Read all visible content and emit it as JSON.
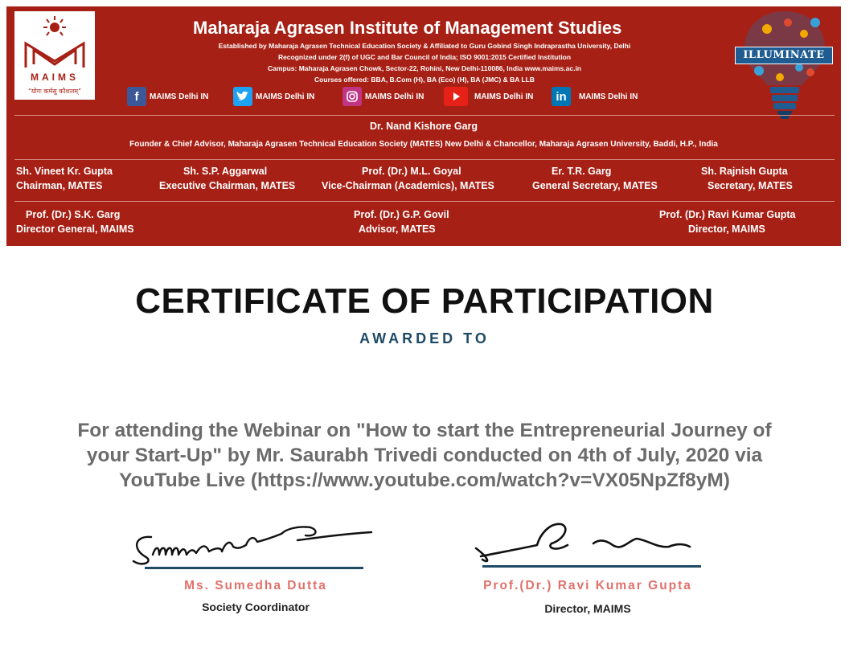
{
  "header": {
    "logo_text": "MAIMS",
    "logo_motto": "“योगः कर्मसु कौशलम्”",
    "institute_name": "Maharaja Agrasen Institute of Management Studies",
    "lines": [
      "Established by Maharaja Agrasen Technical Education Society & Affiliated to Guru Gobind Singh Indraprastha University, Delhi",
      "Recognized under 2(f) of UGC and Bar Council of India; ISO 9001:2015 Certified Institution",
      "Campus: Maharaja Agrasen Chowk, Sector-22, Rohini, New Delhi-110086, India www.maims.ac.in",
      "Courses offered: BBA, B.Com (H), BA (Eco) (H), BA (JMC) & BA LLB"
    ],
    "social": [
      {
        "icon": "facebook-icon",
        "label": "MAIMS Delhi IN",
        "color": "#3b5998"
      },
      {
        "icon": "twitter-icon",
        "label": "MAIMS Delhi IN",
        "color": "#1da1f2"
      },
      {
        "icon": "instagram-icon",
        "label": "MAIMS Delhi IN",
        "color": "#c13584"
      },
      {
        "icon": "youtube-icon",
        "label": "MAIMS Delhi IN",
        "color": "#e62117"
      },
      {
        "icon": "linkedin-icon",
        "label": "MAIMS Delhi IN",
        "color": "#0077b5"
      }
    ],
    "illuminate_label": "ILLUMINATE",
    "founder_name": "Dr. Nand Kishore Garg",
    "founder_role": "Founder & Chief Advisor, Maharaja Agrasen Technical Education Society (MATES) New Delhi & Chancellor, Maharaja Agrasen University, Baddi, H.P., India",
    "row1": [
      {
        "name": "Sh. Vineet Kr. Gupta",
        "role": "Chairman, MATES"
      },
      {
        "name": "Sh. S.P. Aggarwal",
        "role": "Executive Chairman, MATES"
      },
      {
        "name": "Prof. (Dr.) M.L. Goyal",
        "role": "Vice-Chairman (Academics), MATES"
      },
      {
        "name": "Er. T.R. Garg",
        "role": "General Secretary, MATES"
      },
      {
        "name": "Sh. Rajnish Gupta",
        "role": "Secretary, MATES"
      }
    ],
    "row2": [
      {
        "name": "Prof. (Dr.) S.K. Garg",
        "role": "Director General, MAIMS"
      },
      {
        "name": "Prof. (Dr.) G.P. Govil",
        "role": "Advisor, MATES"
      },
      {
        "name": "Prof. (Dr.) Ravi Kumar Gupta",
        "role": "Director, MAIMS"
      }
    ],
    "bg_color": "#a72015"
  },
  "certificate": {
    "title": "CERTIFICATE OF PARTICIPATION",
    "awarded_to": "AWARDED TO",
    "description": "For attending the Webinar on \"How to start the Entrepreneurial Journey of your Start-Up\" by Mr. Saurabh Trivedi conducted on 4th of July, 2020 via YouTube Live (https://www.youtube.com/watch?v=VX05NpZf8yM)"
  },
  "signatories": [
    {
      "name": "Ms. Sumedha Dutta",
      "role": "Society Coordinator"
    },
    {
      "name": "Prof.(Dr.) Ravi Kumar Gupta",
      "role": "Director, MAIMS"
    }
  ]
}
